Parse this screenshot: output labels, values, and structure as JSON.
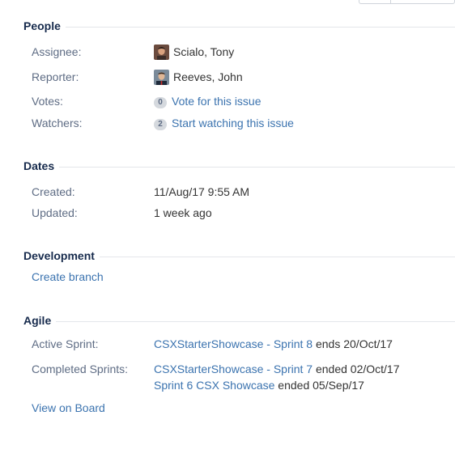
{
  "people": {
    "title": "People",
    "assignee": {
      "label": "Assignee:",
      "name": "Scialo, Tony"
    },
    "reporter": {
      "label": "Reporter:",
      "name": "Reeves, John"
    },
    "votes": {
      "label": "Votes:",
      "count": "0",
      "link": "Vote for this issue"
    },
    "watchers": {
      "label": "Watchers:",
      "count": "2",
      "link": "Start watching this issue"
    }
  },
  "dates": {
    "title": "Dates",
    "created": {
      "label": "Created:",
      "value": "11/Aug/17 9:55 AM"
    },
    "updated": {
      "label": "Updated:",
      "value": "1 week ago"
    }
  },
  "development": {
    "title": "Development",
    "create_branch": "Create branch"
  },
  "agile": {
    "title": "Agile",
    "active_sprint": {
      "label": "Active Sprint:",
      "link": "CSXStarterShowcase - Sprint 8",
      "suffix": "ends 20/Oct/17"
    },
    "completed_sprints": {
      "label": "Completed Sprints:",
      "items": [
        {
          "link": "CSXStarterShowcase - Sprint 7",
          "suffix": "ended 02/Oct/17"
        },
        {
          "link": "Sprint 6 CSX Showcase",
          "suffix": "ended 05/Sep/17"
        }
      ]
    },
    "view_on_board": "View on Board"
  },
  "colors": {
    "link": "#3b73af",
    "label": "#5e6c84",
    "heading": "#172b4d",
    "divider": "#e4e6ea"
  }
}
